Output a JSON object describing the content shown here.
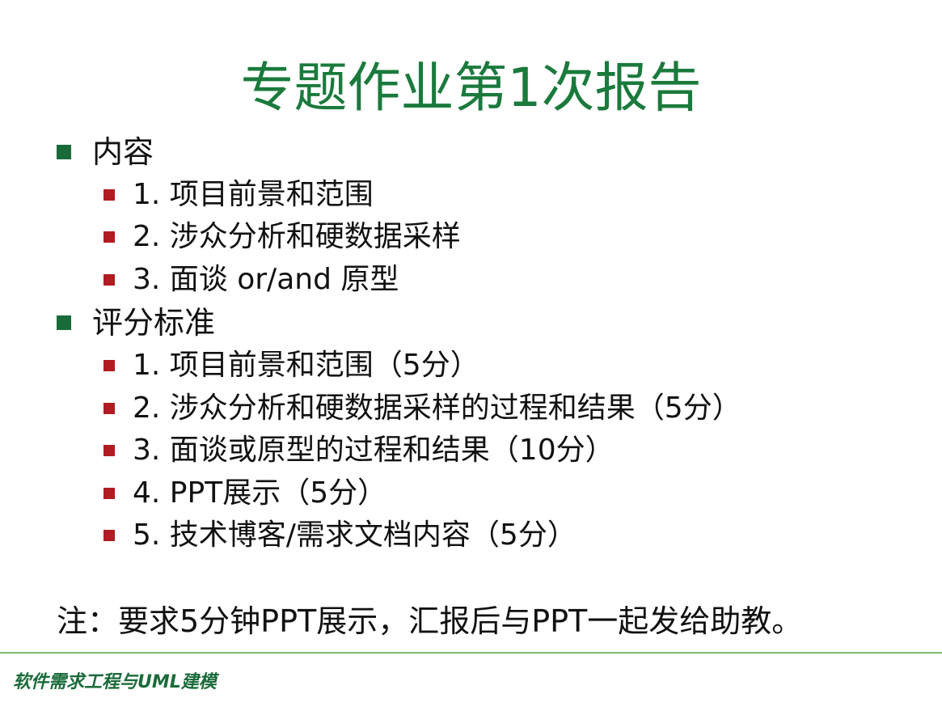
{
  "title": "专题作业第1次报告",
  "sections": [
    {
      "heading": "内容",
      "items": [
        "1. 项目前景和范围",
        "2. 涉众分析和硬数据采样",
        "3. 面谈 or/and 原型"
      ]
    },
    {
      "heading": "评分标准",
      "items": [
        "1. 项目前景和范围（5分）",
        "2. 涉众分析和硬数据采样的过程和结果（5分）",
        "3. 面谈或原型的过程和结果（10分）",
        "4. PPT展示（5分）",
        "5. 技术博客/需求文档内容（5分）"
      ]
    }
  ],
  "note": "注：要求5分钟PPT展示，汇报后与PPT一起发给助教。",
  "footer": "软件需求工程与UML建模",
  "colors": {
    "title": "#1a7a3c",
    "level1_bullet": "#1a6b3a",
    "level2_bullet": "#b01c22",
    "rule": "#7dbb6a"
  }
}
